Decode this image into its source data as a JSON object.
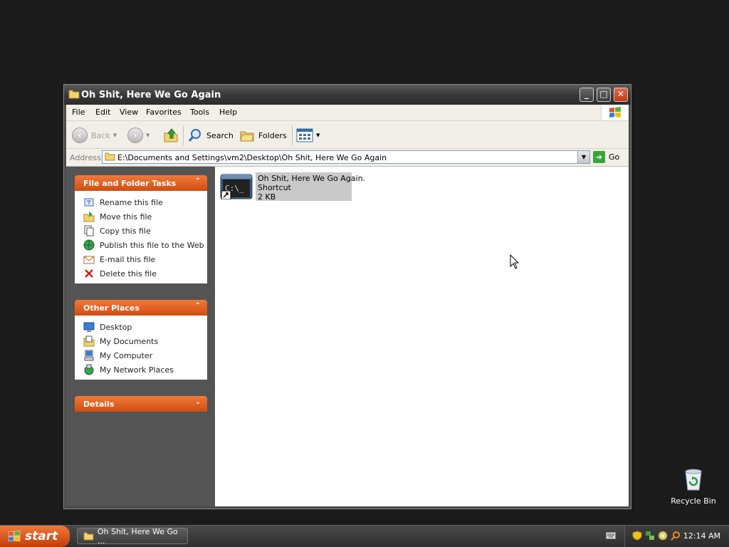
{
  "desktop": {
    "recycle_bin_label": "Recycle Bin"
  },
  "window": {
    "title": "Oh Shit, Here We Go Again",
    "menu": [
      "File",
      "Edit",
      "View",
      "Favorites",
      "Tools",
      "Help"
    ],
    "toolbar": {
      "back": "Back",
      "search": "Search",
      "folders": "Folders"
    },
    "address": {
      "label": "Address",
      "value": "E:\\Documents and Settings\\vm2\\Desktop\\Oh Shit, Here We Go Again",
      "go": "Go"
    }
  },
  "taskpane": {
    "file_folder_tasks": {
      "title": "File and Folder Tasks",
      "items": [
        "Rename this file",
        "Move this file",
        "Copy this file",
        "Publish this file to the Web",
        "E-mail this file",
        "Delete this file"
      ]
    },
    "other_places": {
      "title": "Other Places",
      "items": [
        "Desktop",
        "My Documents",
        "My Computer",
        "My Network Places"
      ]
    },
    "details": {
      "title": "Details"
    }
  },
  "content": {
    "file": {
      "name": "Oh Shit, Here We Go Again.",
      "type": "Shortcut",
      "size": "2 KB",
      "icon_text": "C:\\_"
    }
  },
  "taskbar": {
    "start_label": "start",
    "window_button": "Oh Shit, Here We Go ...",
    "clock": "12:14 AM"
  },
  "colors": {
    "accent": "#d24c10",
    "desktop_bg": "#1b1b1b",
    "pane_bg": "#545454",
    "selection": "#c9c9c9"
  }
}
